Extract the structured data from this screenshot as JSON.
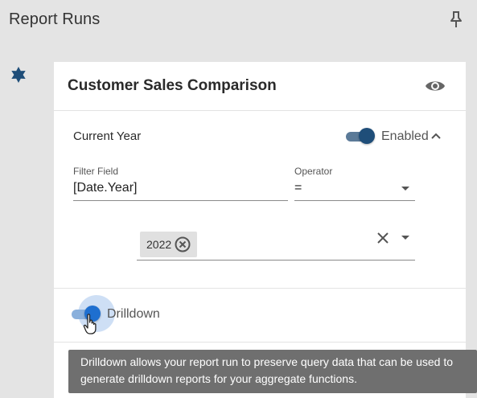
{
  "header": {
    "title": "Report Runs",
    "pin_icon": "pin-icon"
  },
  "sidebar": {
    "icon": "star-icon",
    "accent_color": "#1f4e79"
  },
  "card": {
    "title": "Customer Sales Comparison",
    "visibility_icon": "eye-icon",
    "filter_section": {
      "title": "Current Year",
      "enabled": true,
      "enabled_label": "Enabled",
      "expanded": true,
      "filter_field": {
        "label": "Filter Field",
        "value": "[Date.Year]"
      },
      "operator": {
        "label": "Operator",
        "value": "="
      },
      "values": [
        "2022"
      ]
    },
    "drilldown": {
      "enabled": true,
      "label": "Drilldown",
      "tooltip_lines": [
        "Drilldown allows your report run to preserve query data that can be used to",
        "generate drilldown reports for your aggregate functions."
      ]
    }
  },
  "colors": {
    "background": "#e4e4e4",
    "toggle_enabled": "#1f4e79",
    "toggle_drilldown": "#1e6fd0",
    "tooltip_bg": "#6f6f6f"
  }
}
